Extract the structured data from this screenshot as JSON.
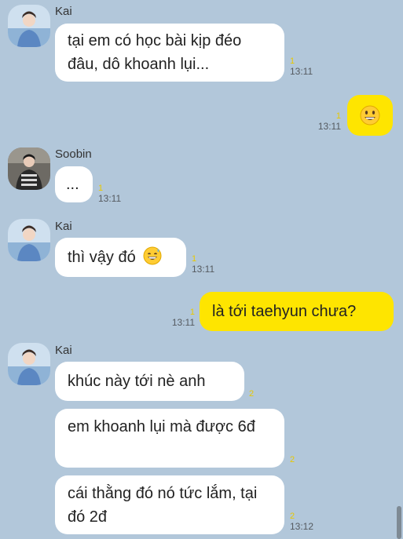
{
  "messages": [
    {
      "sender": "Kai",
      "text": "tại em có học bài kịp đéo đâu, dô khoanh lụi...",
      "unread": "1",
      "time": "13:11"
    },
    {
      "text": "",
      "emoji": "grinning-face",
      "unread": "1",
      "time": "13:11"
    },
    {
      "sender": "Soobin",
      "text": "...",
      "unread": "1",
      "time": "13:11"
    },
    {
      "sender": "Kai",
      "text": "thì vậy đó",
      "emoji": "grinning-face-with-sweat",
      "unread": "1",
      "time": "13:11"
    },
    {
      "text": "là tới taehyun chưa?",
      "unread": "1",
      "time": "13:11"
    },
    {
      "sender": "Kai",
      "text": "khúc này tới nè anh",
      "unread": "2"
    },
    {
      "text": "em khoanh lụi mà được 6đ",
      "unread": "2"
    },
    {
      "text": "cái thằng đó nó tức lắm, tại đó 2đ",
      "unread": "2",
      "time": "13:12"
    }
  ],
  "colors": {
    "background": "#b2c7da",
    "incoming_bubble": "#ffffff",
    "outgoing_bubble": "#fee500",
    "unread_count": "#e8c800"
  }
}
